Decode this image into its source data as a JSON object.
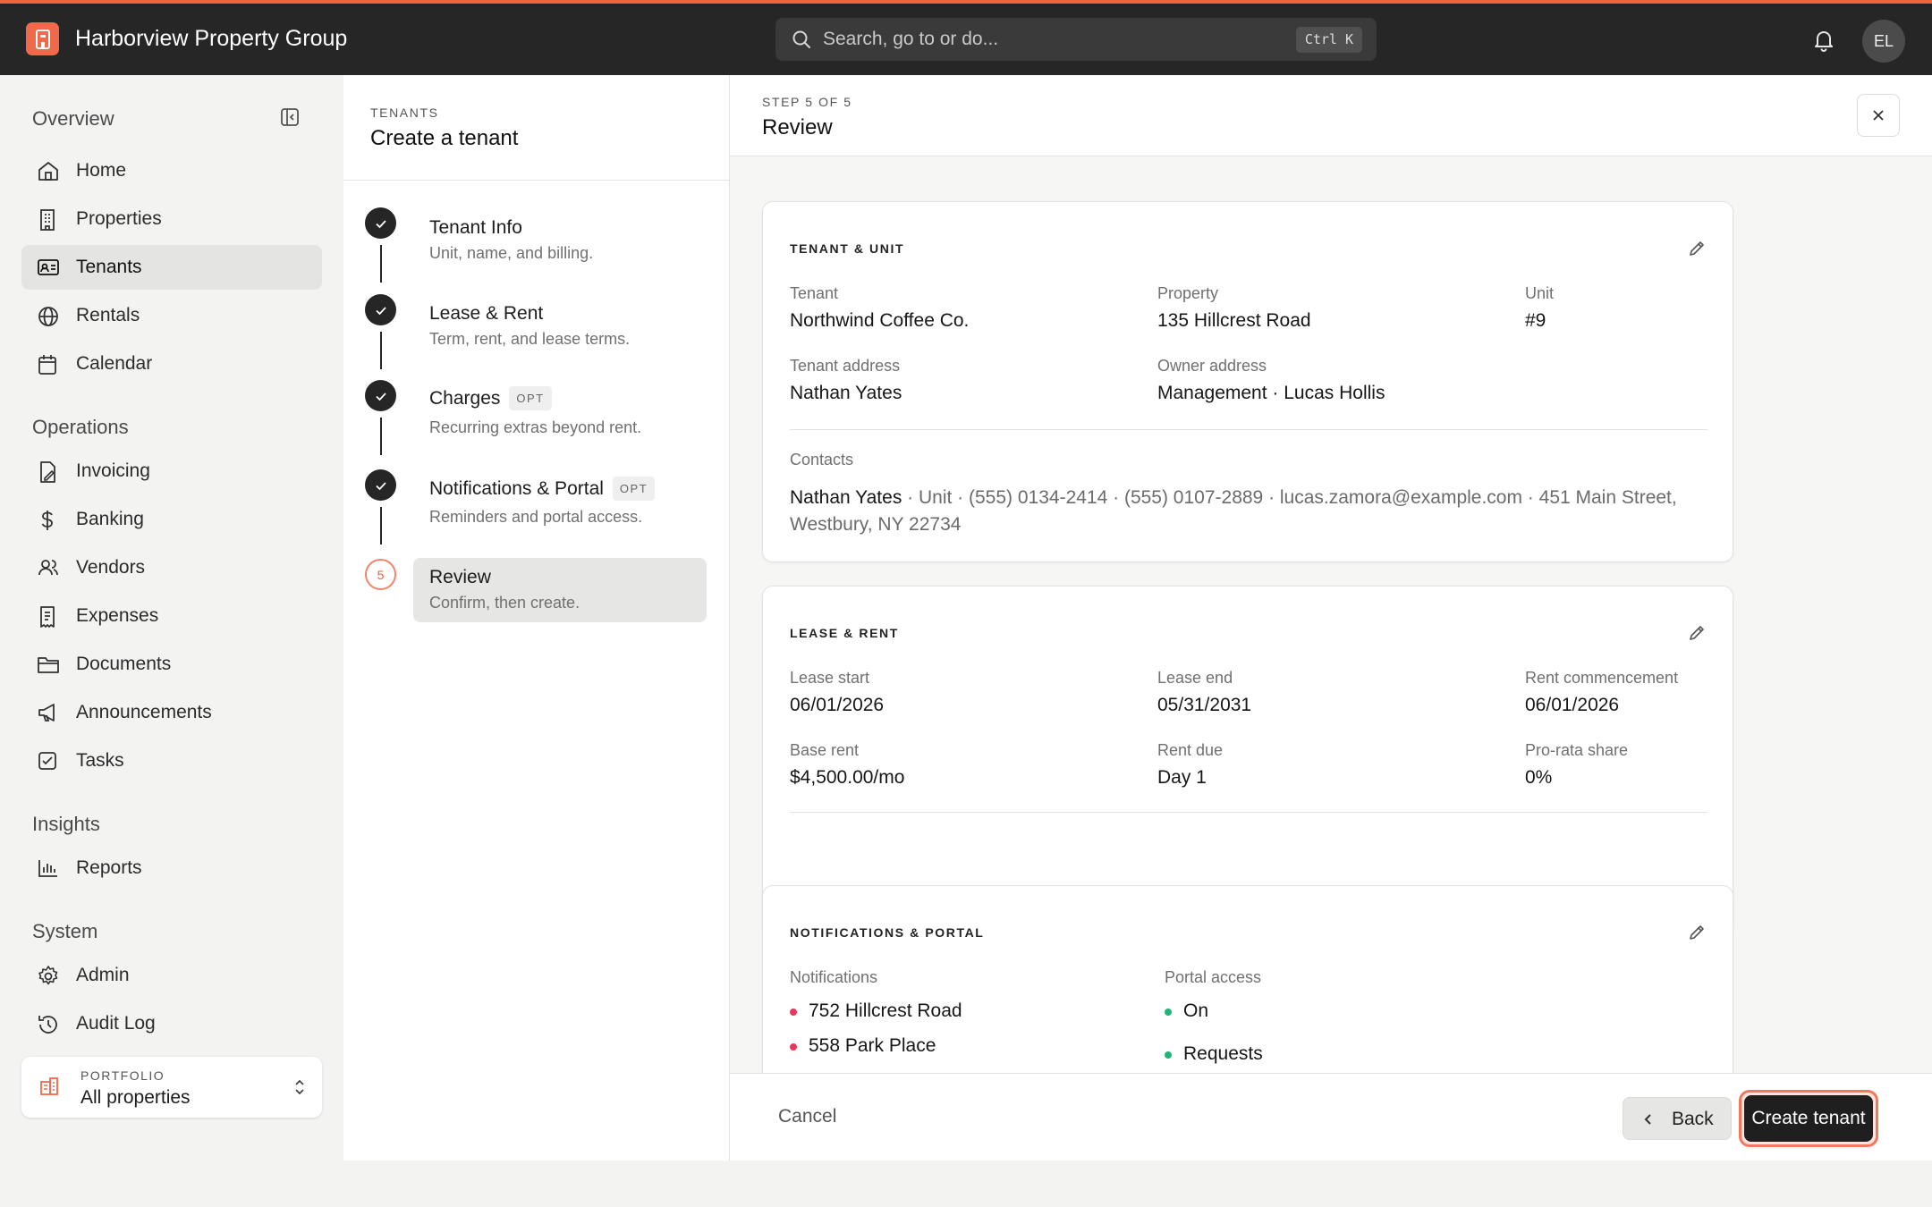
{
  "app": {
    "title": "Harborview Property Group",
    "user_initials": "EL"
  },
  "search": {
    "placeholder": "Search, go to or do...",
    "shortcut": "Ctrl K"
  },
  "colors": {
    "accent": "#f0643c",
    "dark": "#262626",
    "bullet_red": "#e8375a",
    "bullet_green": "#21b47a"
  },
  "sidebar": {
    "overview": "Overview",
    "operations": "Operations",
    "insights": "Insights",
    "system": "System",
    "items": {
      "home": "Home",
      "properties": "Properties",
      "tenants": "Tenants",
      "rentals": "Rentals",
      "calendar": "Calendar",
      "invoicing": "Invoicing",
      "banking": "Banking",
      "vendors": "Vendors",
      "expenses": "Expenses",
      "documents": "Documents",
      "announcements": "Announcements",
      "tasks": "Tasks",
      "reports": "Reports",
      "admin": "Admin",
      "audit_log": "Audit Log"
    },
    "active": "tenants",
    "portfolio": {
      "caption": "PORTFOLIO",
      "value": "All properties"
    }
  },
  "wizard": {
    "eyebrow": "TENANTS",
    "title": "Create a tenant",
    "steps": [
      {
        "title": "Tenant Info",
        "subtitle": "Unit, name, and billing.",
        "status": "done"
      },
      {
        "title": "Lease & Rent",
        "subtitle": "Term, rent, and lease terms.",
        "status": "done"
      },
      {
        "title": "Charges",
        "subtitle": "Recurring extras beyond rent.",
        "status": "done",
        "badge": "OPT"
      },
      {
        "title": "Notifications & Portal",
        "subtitle": "Reminders and portal access.",
        "status": "done",
        "badge": "OPT"
      },
      {
        "title": "Review",
        "subtitle": "Confirm, then create.",
        "status": "current",
        "number": "5"
      }
    ]
  },
  "main": {
    "eyebrow": "STEP 5 OF 5",
    "title": "Review",
    "tenant_unit": {
      "title": "TENANT & UNIT",
      "tenant_label": "Tenant",
      "tenant": "Northwind Coffee Co.",
      "property_label": "Property",
      "property": "135 Hillcrest Road",
      "unit_label": "Unit",
      "unit": "#9",
      "tenant_address_label": "Tenant address",
      "tenant_address": "Nathan Yates",
      "owner_address_label": "Owner address",
      "owner_address": "Management · Lucas Hollis",
      "contacts_label": "Contacts",
      "contact_name": "Nathan Yates",
      "contact_rest": " · Unit · (555) 0134-2414 · (555) 0107-2889 · lucas.zamora@example.com · 451 Main Street, Westbury, NY 22734"
    },
    "lease_rent": {
      "title": "LEASE & RENT",
      "lease_start_label": "Lease start",
      "lease_start": "06/01/2026",
      "lease_end_label": "Lease end",
      "lease_end": "05/31/2031",
      "rent_commencement_label": "Rent commencement",
      "rent_commencement": "06/01/2026",
      "base_rent_label": "Base rent",
      "base_rent": "$4,500.00/mo",
      "rent_due_label": "Rent due",
      "rent_due": "Day 1",
      "prorata_label": "Pro-rata share",
      "prorata": "0%"
    },
    "notifications": {
      "title": "NOTIFICATIONS & PORTAL",
      "notifications_label": "Notifications",
      "notification_items": [
        "752 Hillcrest Road",
        "558 Park Place"
      ],
      "portal_label": "Portal access",
      "portal_items": [
        "On",
        "Requests"
      ]
    },
    "footer": {
      "cancel": "Cancel",
      "back": "Back",
      "create": "Create tenant"
    }
  }
}
